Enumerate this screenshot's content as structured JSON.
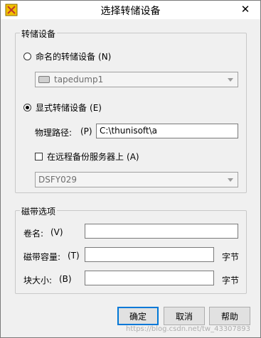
{
  "window": {
    "title": "选择转储设备",
    "close_glyph": "✕"
  },
  "device_group": {
    "title": "转储设备",
    "named_option": {
      "label": "命名的转储设备",
      "accel": "(N)",
      "selected": false
    },
    "named_combo": {
      "value": "tapedump1",
      "icon": "tape-drive-icon"
    },
    "explicit_option": {
      "label": "显式转储设备",
      "accel": "(E)",
      "selected": true
    },
    "physical_path": {
      "label": "物理路径:",
      "accel": "(P)",
      "value": "C:\\thunisoft\\a"
    },
    "remote_backup": {
      "label": "在远程备份服务器上",
      "accel": "(A)",
      "checked": false
    },
    "server_combo": {
      "value": "DSFY029"
    }
  },
  "tape_group": {
    "title": "磁带选项",
    "volume_name": {
      "label": "卷名:",
      "accel": "(V)",
      "value": ""
    },
    "tape_capacity": {
      "label": "磁带容量:",
      "accel": "(T)",
      "value": "",
      "unit": "字节"
    },
    "block_size": {
      "label": "块大小:",
      "accel": "(B)",
      "value": "",
      "unit": "字节"
    }
  },
  "buttons": {
    "ok": "确定",
    "cancel": "取消",
    "help": "帮助"
  },
  "watermark": "https://blog.csdn.net/tw_43307893"
}
